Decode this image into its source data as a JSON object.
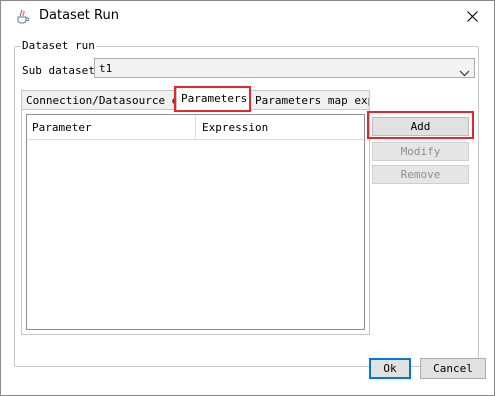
{
  "window": {
    "title": "Dataset Run",
    "app_icon": "java-cup-icon",
    "close_icon": "close-icon"
  },
  "group": {
    "legend": "Dataset run"
  },
  "sub_dataset": {
    "label": "Sub dataset",
    "value": "t1"
  },
  "tabs": [
    {
      "label": "Connection/Datasource exp",
      "active": false
    },
    {
      "label": "Parameters",
      "active": true
    },
    {
      "label": "Parameters map exp",
      "active": false
    }
  ],
  "table": {
    "columns": [
      "Parameter",
      "Expression"
    ],
    "rows": []
  },
  "side_buttons": {
    "add": "Add",
    "modify": "Modify",
    "remove": "Remove"
  },
  "footer": {
    "ok": "Ok",
    "cancel": "Cancel"
  },
  "colors": {
    "highlight": "#e5262b",
    "focus_border": "#0078d7"
  }
}
